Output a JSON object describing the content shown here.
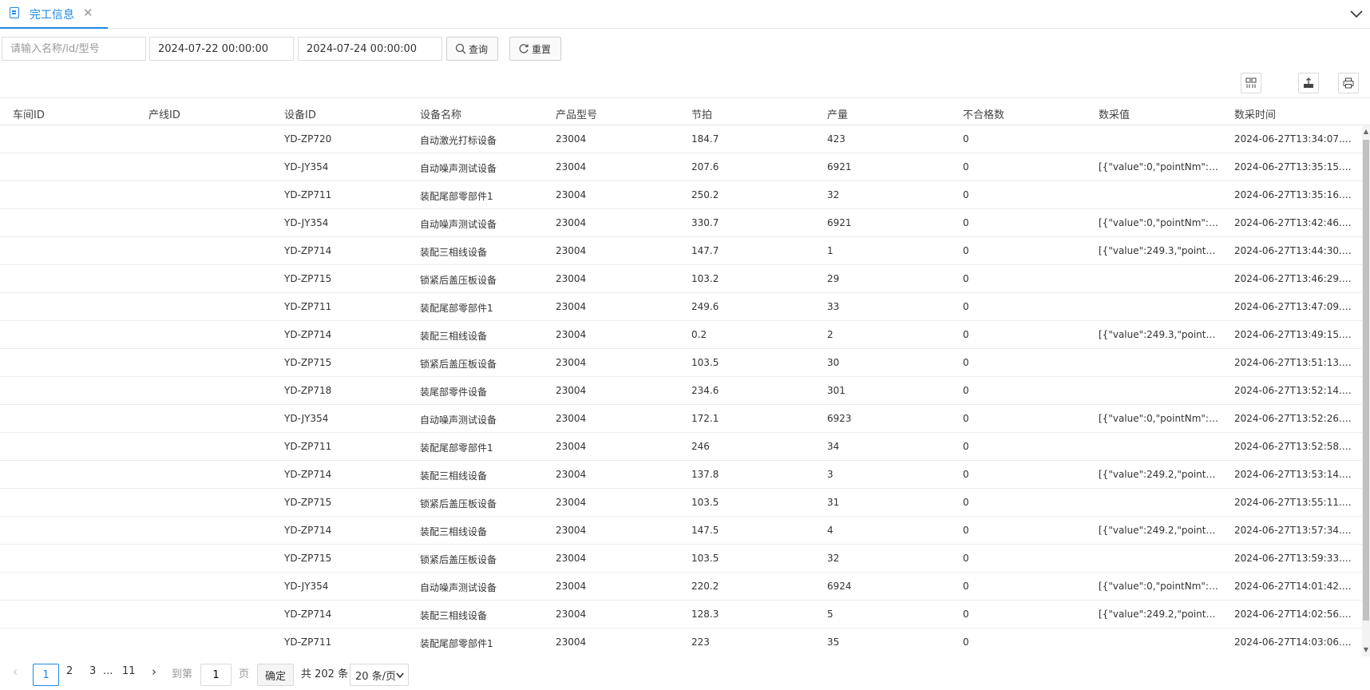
{
  "tab": {
    "label": "完工信息"
  },
  "toolbar": {
    "search_placeholder": "请输入名称/id/型号",
    "start_date": "2024-07-22 00:00:00",
    "end_date": "2024-07-24 00:00:00",
    "query_label": "查询",
    "reset_label": "重置"
  },
  "columns": [
    "车间ID",
    "产线ID",
    "设备ID",
    "设备名称",
    "产品型号",
    "节拍",
    "产量",
    "不合格数",
    "数采值",
    "数采时间"
  ],
  "rows": [
    [
      "",
      "",
      "YD-ZP720",
      "自动激光打标设备",
      "23004",
      "184.7",
      "423",
      "0",
      "",
      "2024-06-27T13:34:07.0..."
    ],
    [
      "",
      "",
      "YD-JY354",
      "自动噪声测试设备",
      "23004",
      "207.6",
      "6921",
      "0",
      "[{\"value\":0,\"pointNm\":\"d...",
      "2024-06-27T13:35:15.2..."
    ],
    [
      "",
      "",
      "YD-ZP711",
      "装配尾部零部件1",
      "23004",
      "250.2",
      "32",
      "0",
      "",
      "2024-06-27T13:35:16.4..."
    ],
    [
      "",
      "",
      "YD-JY354",
      "自动噪声测试设备",
      "23004",
      "330.7",
      "6921",
      "0",
      "[{\"value\":0,\"pointNm\":\"d...",
      "2024-06-27T13:42:46.5..."
    ],
    [
      "",
      "",
      "YD-ZP714",
      "装配三相线设备",
      "23004",
      "147.7",
      "1",
      "0",
      "[{\"value\":249.3,\"pointN...",
      "2024-06-27T13:44:30.0..."
    ],
    [
      "",
      "",
      "YD-ZP715",
      "锁紧后盖压板设备",
      "23004",
      "103.2",
      "29",
      "0",
      "",
      "2024-06-27T13:46:29.8..."
    ],
    [
      "",
      "",
      "YD-ZP711",
      "装配尾部零部件1",
      "23004",
      "249.6",
      "33",
      "0",
      "",
      "2024-06-27T13:47:09.2..."
    ],
    [
      "",
      "",
      "YD-ZP714",
      "装配三相线设备",
      "23004",
      "0.2",
      "2",
      "0",
      "[{\"value\":249.3,\"pointN...",
      "2024-06-27T13:49:15.1..."
    ],
    [
      "",
      "",
      "YD-ZP715",
      "锁紧后盖压板设备",
      "23004",
      "103.5",
      "30",
      "0",
      "",
      "2024-06-27T13:51:13.8..."
    ],
    [
      "",
      "",
      "YD-ZP718",
      "装尾部零件设备",
      "23004",
      "234.6",
      "301",
      "0",
      "",
      "2024-06-27T13:52:14.7..."
    ],
    [
      "",
      "",
      "YD-JY354",
      "自动噪声测试设备",
      "23004",
      "172.1",
      "6923",
      "0",
      "[{\"value\":0,\"pointNm\":\"d...",
      "2024-06-27T13:52:26.7..."
    ],
    [
      "",
      "",
      "YD-ZP711",
      "装配尾部零部件1",
      "23004",
      "246",
      "34",
      "0",
      "",
      "2024-06-27T13:52:58.5..."
    ],
    [
      "",
      "",
      "YD-ZP714",
      "装配三相线设备",
      "23004",
      "137.8",
      "3",
      "0",
      "[{\"value\":249.2,\"pointN...",
      "2024-06-27T13:53:14.5..."
    ],
    [
      "",
      "",
      "YD-ZP715",
      "锁紧后盖压板设备",
      "23004",
      "103.5",
      "31",
      "0",
      "",
      "2024-06-27T13:55:11.6..."
    ],
    [
      "",
      "",
      "YD-ZP714",
      "装配三相线设备",
      "23004",
      "147.5",
      "4",
      "0",
      "[{\"value\":249.2,\"pointN...",
      "2024-06-27T13:57:34.6..."
    ],
    [
      "",
      "",
      "YD-ZP715",
      "锁紧后盖压板设备",
      "23004",
      "103.5",
      "32",
      "0",
      "",
      "2024-06-27T13:59:33.7..."
    ],
    [
      "",
      "",
      "YD-JY354",
      "自动噪声测试设备",
      "23004",
      "220.2",
      "6924",
      "0",
      "[{\"value\":0,\"pointNm\":\"d...",
      "2024-06-27T14:01:42.6..."
    ],
    [
      "",
      "",
      "YD-ZP714",
      "装配三相线设备",
      "23004",
      "128.3",
      "5",
      "0",
      "[{\"value\":249.2,\"pointN...",
      "2024-06-27T14:02:56.6..."
    ],
    [
      "",
      "",
      "YD-ZP711",
      "装配尾部零部件1",
      "23004",
      "223",
      "35",
      "0",
      "",
      "2024-06-27T14:03:06.6..."
    ]
  ],
  "pagination": {
    "pages": [
      "1",
      "2",
      "3"
    ],
    "ellipsis": "...",
    "last_page": "11",
    "goto_label": "到第",
    "goto_value": "1",
    "page_suffix": "页",
    "confirm_label": "确定",
    "total_label": "共 202 条",
    "page_size": "20 条/页"
  }
}
